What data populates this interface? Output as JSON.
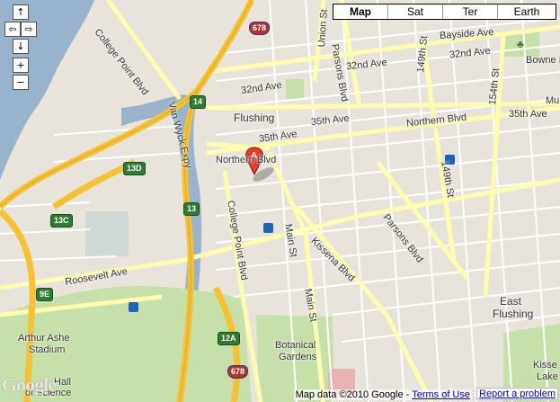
{
  "map": {
    "type_buttons": [
      {
        "label": "Map",
        "active": true
      },
      {
        "label": "Sat",
        "active": false
      },
      {
        "label": "Ter",
        "active": false
      },
      {
        "label": "Earth",
        "active": false
      }
    ],
    "nav": {
      "up": "↑",
      "left": "⇦",
      "right": "⇨",
      "down": "↓",
      "zoom_in": "+",
      "zoom_out": "−"
    },
    "marker": {
      "letter": "A"
    },
    "labels": {
      "college_point_blvd_top": "College Point Blvd",
      "northern_blvd_left": "Northern Blvd",
      "northern_blvd_right": "Northern Blvd",
      "flushing": "Flushing",
      "union_st": "Union St",
      "parsons_blvd_top": "Parsons Blvd",
      "149th_st_top": "149th St",
      "bayside_ave": "Bayside Ave",
      "32nd_ave_left": "32nd Ave",
      "32nd_ave_mid": "32nd Ave",
      "32nd_ave_right": "32nd Ave",
      "bowne_park": "Bowne Park",
      "154th_st": "154th St",
      "35th_ave_left": "35th Ave",
      "35th_ave_mid": "35th Ave",
      "35th_ave_right": "35th Ave",
      "van_wyck": "Van Wyck Expy",
      "college_point_blvd_mid": "College Point Blvd",
      "main_st_top": "Main St",
      "main_st_bottom": "Main St",
      "kissena_blvd": "Kissena Blvd",
      "parsons_blvd_bottom": "Parsons Blvd",
      "149th_st_bottom": "149th St",
      "roosevelt_ave": "Roosevelt Ave",
      "east_flushing_1": "East",
      "east_flushing_2": "Flushing",
      "arthur_ashe_1": "Arthur Ashe",
      "arthur_ashe_2": "Stadium",
      "botanical_1": "Botanical",
      "botanical_2": "Gardens",
      "kissena_lake_1": "Kisse",
      "kissena_lake_2": "Lake",
      "hall_of_science_1": "Hall",
      "hall_of_science_2": "of Science",
      "mu_edge": "Mu"
    },
    "shields": {
      "i678_top": "678",
      "r14": "14",
      "r13d": "13D",
      "r13c": "13C",
      "r13": "13",
      "r9e": "9E",
      "r12a": "12A",
      "i678_bottom": "678"
    },
    "logo": "Google",
    "footer": {
      "data_text": "Map data ©2010 Google - ",
      "terms": "Terms of Use",
      "report": "Report a problem"
    }
  },
  "colors": {
    "land": "#e8e4dc",
    "water": "#99b3cc",
    "park": "#c7dfa8",
    "highway": "#f5c235",
    "arterial": "#fffdb0",
    "street": "#ffffff"
  }
}
